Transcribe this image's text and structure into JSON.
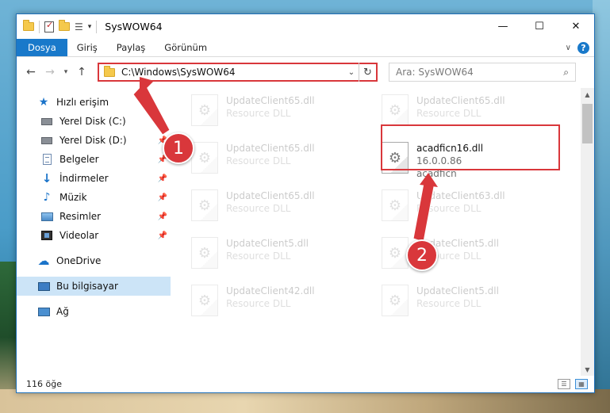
{
  "window": {
    "title": "SysWOW64",
    "minimize_glyph": "—",
    "maximize_glyph": "☐",
    "close_glyph": "✕"
  },
  "ribbon": {
    "tabs": [
      "Dosya",
      "Giriş",
      "Paylaş",
      "Görünüm"
    ],
    "help_label": "?"
  },
  "address": {
    "path": "C:\\Windows\\SysWOW64",
    "search_placeholder": "Ara: SysWOW64"
  },
  "nav": {
    "quick_access": "Hızlı erişim",
    "items": [
      {
        "label": "Yerel Disk (C:)",
        "icon": "drive-icon",
        "pinned": false
      },
      {
        "label": "Yerel Disk (D:)",
        "icon": "drive-icon",
        "pinned": true
      },
      {
        "label": "Belgeler",
        "icon": "documents-icon",
        "pinned": true
      },
      {
        "label": "İndirmeler",
        "icon": "downloads-icon",
        "pinned": true
      },
      {
        "label": "Müzik",
        "icon": "music-icon",
        "pinned": true
      },
      {
        "label": "Resimler",
        "icon": "pictures-icon",
        "pinned": true
      },
      {
        "label": "Videolar",
        "icon": "videos-icon",
        "pinned": true
      }
    ],
    "onedrive": "OneDrive",
    "this_pc": "Bu bilgisayar",
    "network": "Ağ"
  },
  "files": {
    "left_column": [
      {
        "name": "UpdateClient65.dll",
        "sub": "Resource DLL"
      },
      {
        "name": "UpdateClient65.dll",
        "sub": "Resource DLL"
      },
      {
        "name": "UpdateClient65.dll",
        "sub": "Resource DLL"
      },
      {
        "name": "UpdateClient5.dll",
        "sub": "Resource DLL"
      },
      {
        "name": "UpdateClient42.dll",
        "sub": "Resource DLL"
      }
    ],
    "right_column": [
      {
        "name": "UpdateClient65.dll",
        "sub": "Resource DLL"
      },
      {
        "name": "UpdateClient63.dll",
        "sub": "Resource DLL"
      },
      {
        "name": "UpdateClient5.dll",
        "sub": "Resource DLL"
      },
      {
        "name": "UpdateClient5.dll",
        "sub": "Resource DLL"
      }
    ],
    "highlighted": {
      "name": "acadficn16.dll",
      "version": "16.0.0.86",
      "description": "acadficn"
    }
  },
  "status": {
    "item_count": "116 öğe"
  },
  "annotations": {
    "marker1": "1",
    "marker2": "2",
    "color": "#d9373b"
  }
}
